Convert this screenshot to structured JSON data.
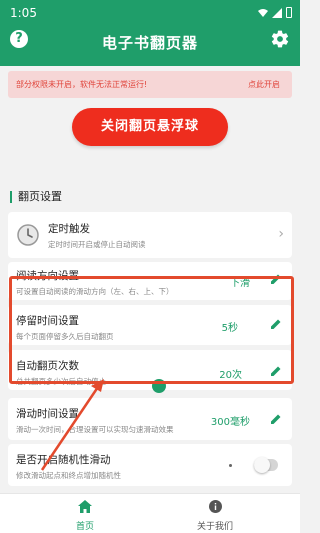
{
  "status_bar": {
    "time": "1:05"
  },
  "app_bar": {
    "title": "电子书翻页器",
    "help_icon": "help-icon",
    "settings_icon": "gear-icon"
  },
  "warning": {
    "text": "部分权限未开启，软件无法正常运行!",
    "action": "点此开启"
  },
  "float_button": {
    "label": "关闭翻页悬浮球"
  },
  "section": {
    "title": "翻页设置"
  },
  "settings": [
    {
      "title": "定时触发",
      "desc": "定时时间开启或停止自动阅读",
      "value": ""
    },
    {
      "title": "阅读方向设置",
      "desc": "可设置自动阅读的滑动方向（左、右、上、下）",
      "value": "下滑"
    },
    {
      "title": "停留时间设置",
      "desc": "每个页面停留多久后自动翻页",
      "value": "5秒"
    },
    {
      "title": "自动翻页次数",
      "desc": "总共翻页多少次后自动停止",
      "value": "20次"
    },
    {
      "title": "滑动时间设置",
      "desc": "滑动一次时间，合理设置可以实现匀速滑动效果",
      "value": "300毫秒"
    },
    {
      "title": "是否开启随机性滑动",
      "desc": "修改滑动起点和终点增加随机性",
      "value": ""
    }
  ],
  "bottom_nav": [
    {
      "label": "首页",
      "icon": "home-icon",
      "active": true
    },
    {
      "label": "关于我们",
      "icon": "info-icon",
      "active": false
    }
  ],
  "colors": {
    "primary": "#1f9e6a",
    "danger": "#ee2d1e",
    "highlight": "#e34a2d"
  }
}
